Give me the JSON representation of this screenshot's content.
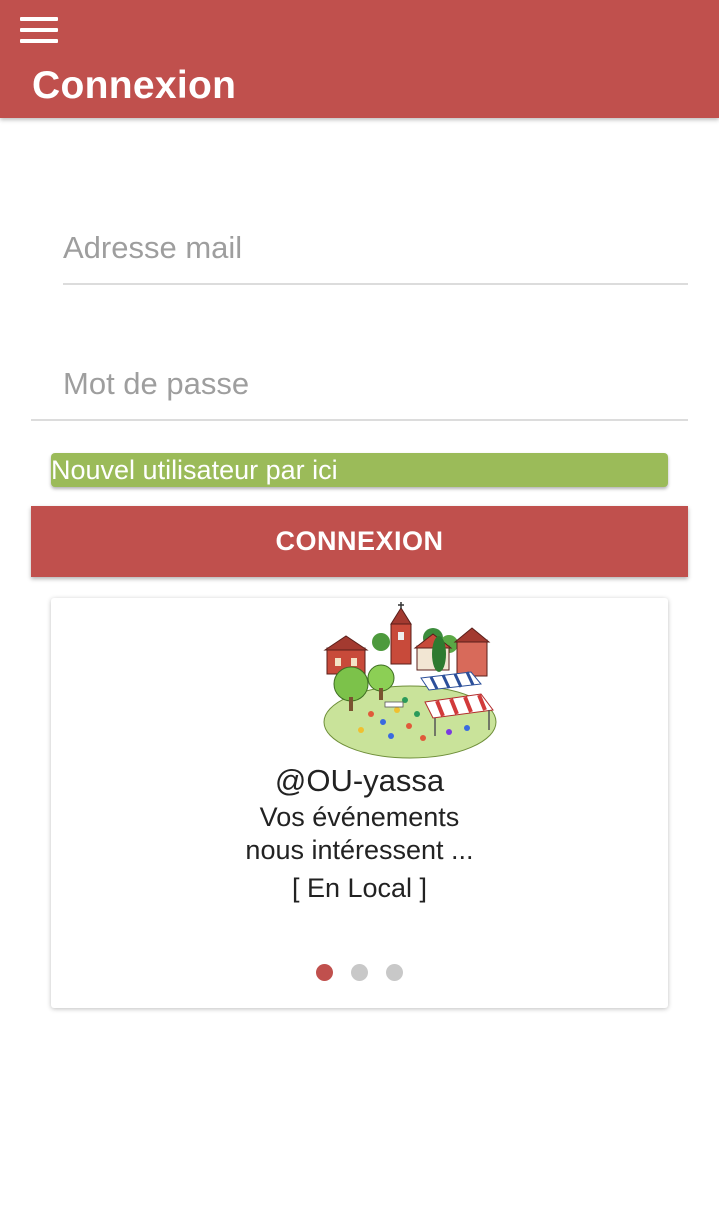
{
  "header": {
    "title": "Connexion",
    "menu_icon": "hamburger-menu-icon",
    "background_color": "#c0504d"
  },
  "login_form": {
    "email_placeholder": "Adresse mail",
    "email_value": "",
    "password_placeholder": "Mot de passe",
    "password_value": "",
    "new_user_label": "Nouvel utilisateur par ici",
    "new_user_color": "#9bbb59",
    "submit_label": "CONNEXION",
    "submit_color": "#c0504d"
  },
  "carousel": {
    "illustration_icon": "village-market-illustration",
    "title": "@OU-yassa",
    "line1": "Vos événements",
    "line2": "nous intéressent ...",
    "line3": "[ En Local ]",
    "slide_count": 3,
    "active_slide": 1
  }
}
